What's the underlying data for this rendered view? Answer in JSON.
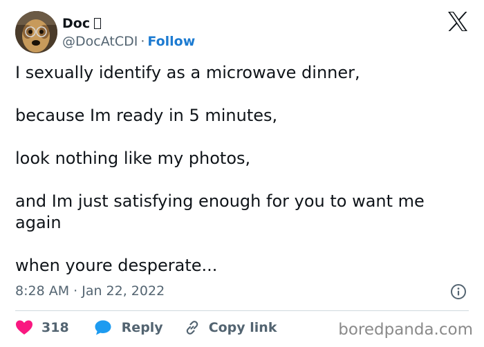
{
  "author": {
    "display_name": "Doc",
    "handle": "@DocAtCDI",
    "separator": "·",
    "follow_label": "Follow"
  },
  "tweet": {
    "lines": [
      "I sexually identify as a microwave dinner,",
      "because Im ready in 5 minutes,",
      "look nothing like my photos,",
      "and Im just satisfying enough for you to want me again",
      "when youre desperate..."
    ],
    "timestamp": "8:28 AM · Jan 22, 2022"
  },
  "actions": {
    "like_count": "318",
    "reply_label": "Reply",
    "copy_link_label": "Copy link"
  },
  "watermark": "boredpanda.com",
  "colors": {
    "like": "#f91880",
    "reply": "#1d9bf0",
    "follow": "#1d7bd1",
    "muted": "#536471"
  },
  "icons": [
    "x-logo-icon",
    "info-icon",
    "heart-icon",
    "reply-bubble-icon",
    "link-icon"
  ]
}
